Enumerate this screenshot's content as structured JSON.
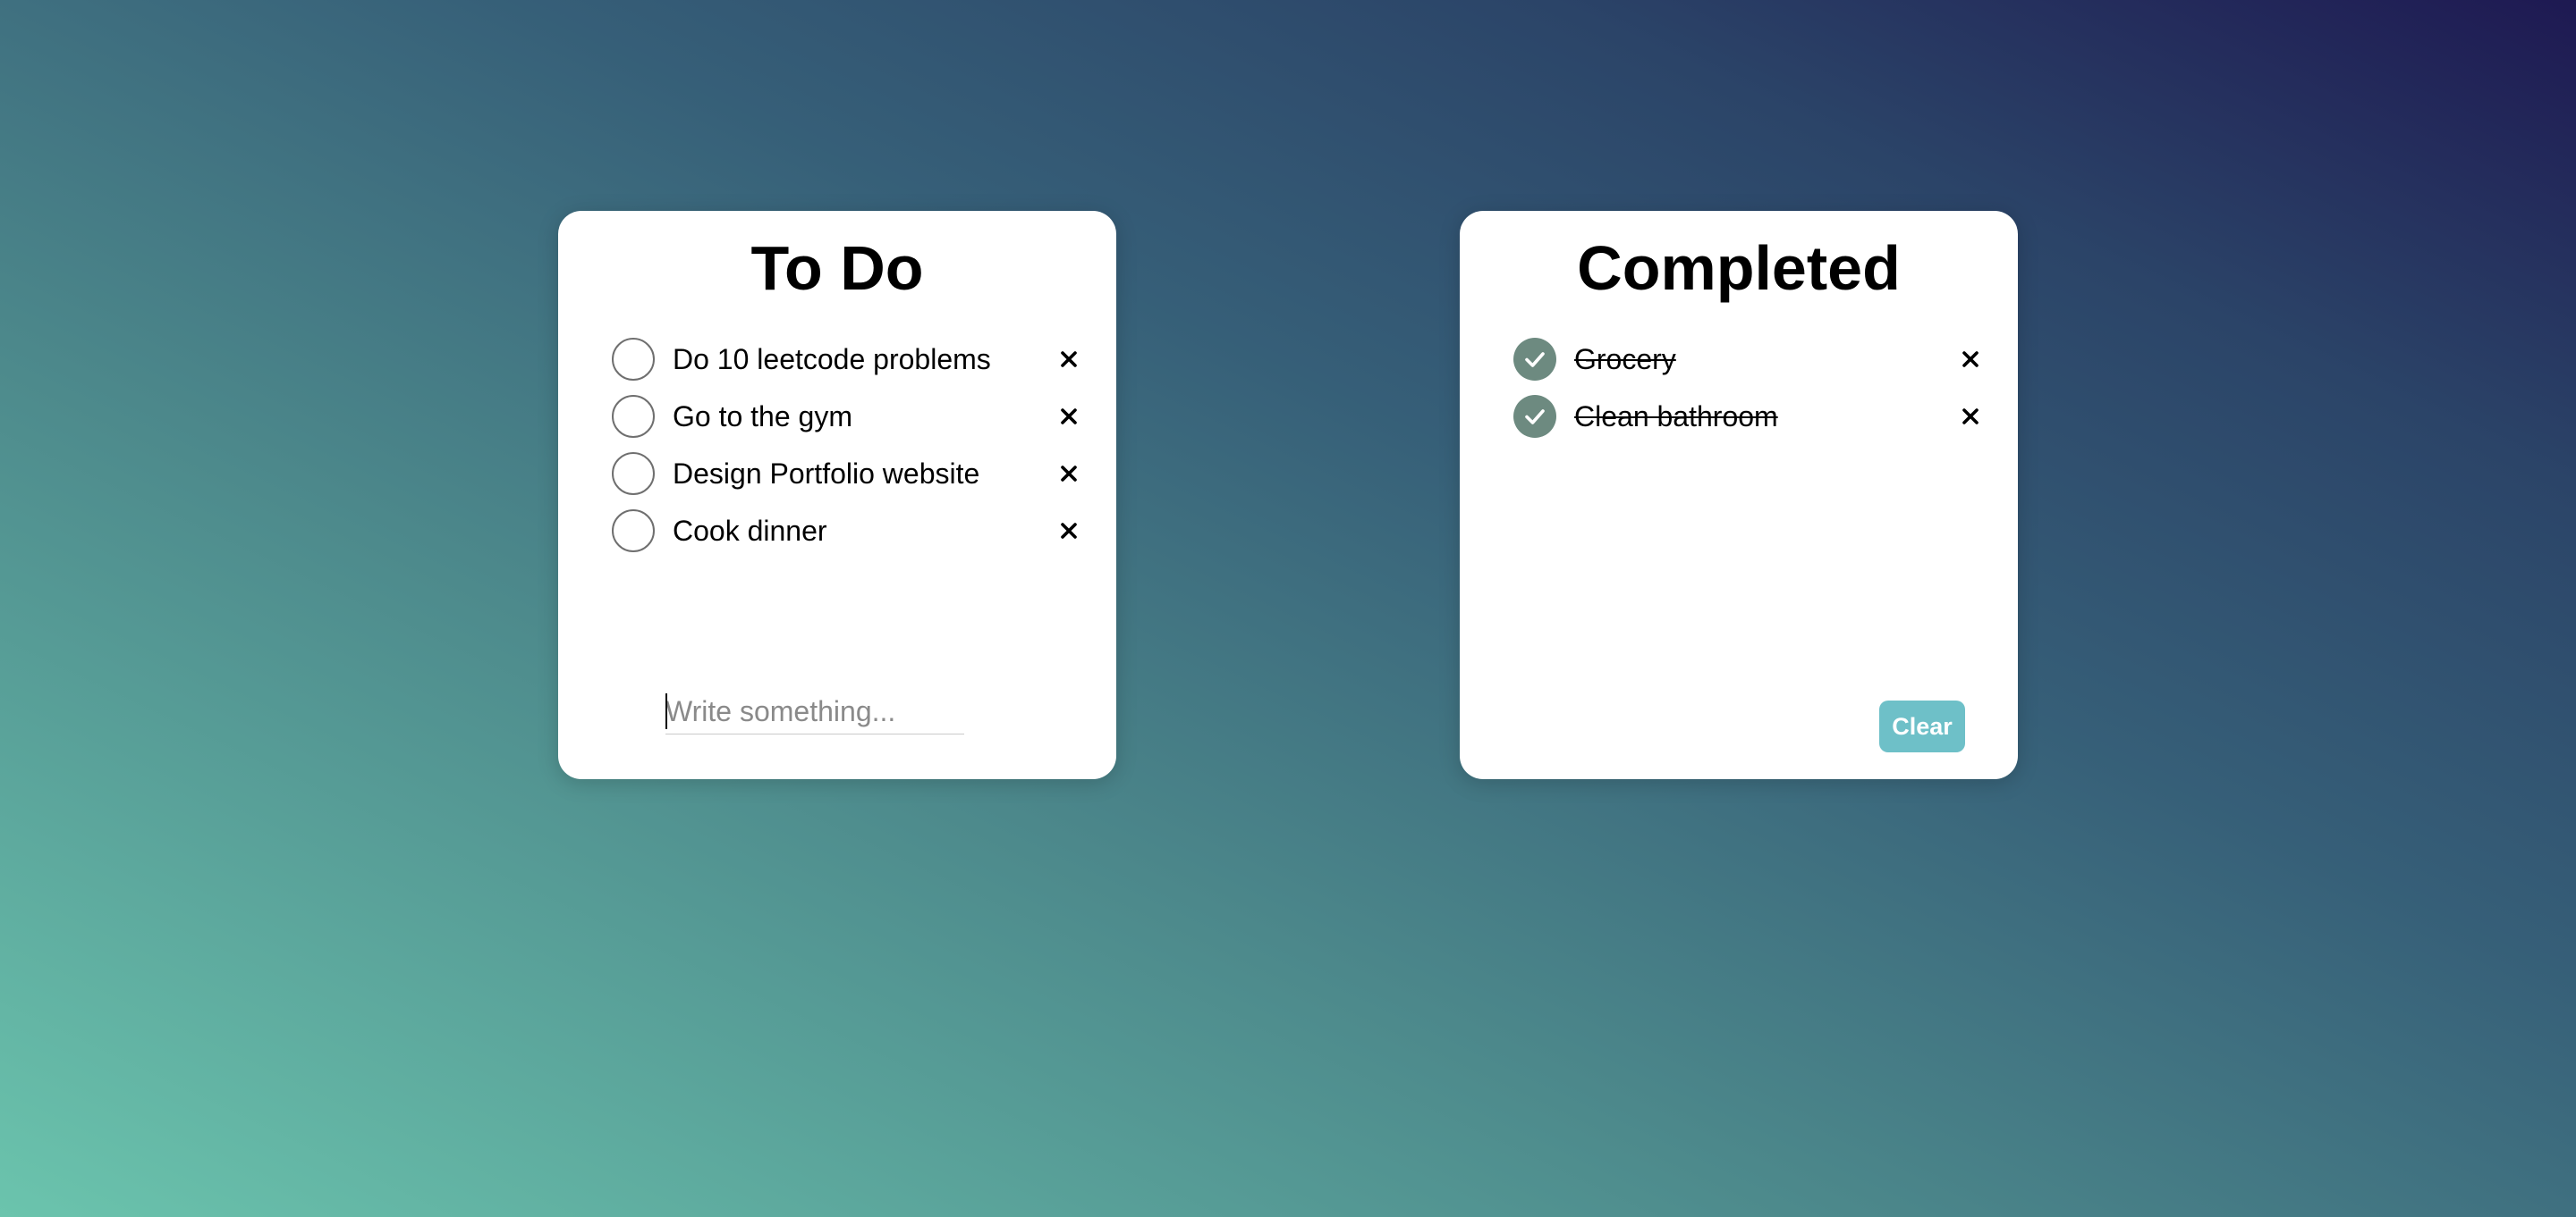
{
  "todo": {
    "title": "To Do",
    "items": [
      {
        "text": "Do 10 leetcode problems"
      },
      {
        "text": "Go to the gym"
      },
      {
        "text": "Design Portfolio website"
      },
      {
        "text": "Cook dinner"
      }
    ],
    "input": {
      "placeholder": "Write something...",
      "value": ""
    }
  },
  "completed": {
    "title": "Completed",
    "items": [
      {
        "text": "Grocery"
      },
      {
        "text": "Clean bathroom"
      }
    ],
    "clear_label": "Clear"
  },
  "colors": {
    "check_fill": "#6d8a80",
    "clear_button": "#6ec0c8",
    "background_start": "#6bc4ad",
    "background_end": "#1e1952"
  },
  "icons": {
    "unchecked": "empty-circle-icon",
    "checked": "checkmark-circle-icon",
    "delete": "close-x-icon"
  }
}
